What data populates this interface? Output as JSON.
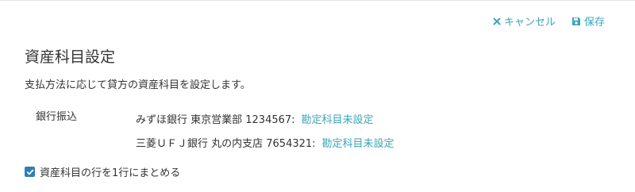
{
  "header": {
    "cancel_label": "キャンセル",
    "save_label": "保存",
    "accent_color": "#3aa6b9"
  },
  "page": {
    "title": "資産科目設定",
    "description": "支払方法に応じて貸方の資産科目を設定します。"
  },
  "method": {
    "label": "銀行振込",
    "accounts": [
      {
        "bank": "みずほ銀行 東京営業部 1234567:",
        "link_label": "勘定科目未設定"
      },
      {
        "bank": "三菱ＵＦＪ銀行 丸の内支店 7654321:",
        "link_label": "勘定科目未設定"
      }
    ]
  },
  "option": {
    "label": "資産科目の行を1行にまとめる",
    "checked": true,
    "checkbox_color": "#2e7fb8"
  }
}
